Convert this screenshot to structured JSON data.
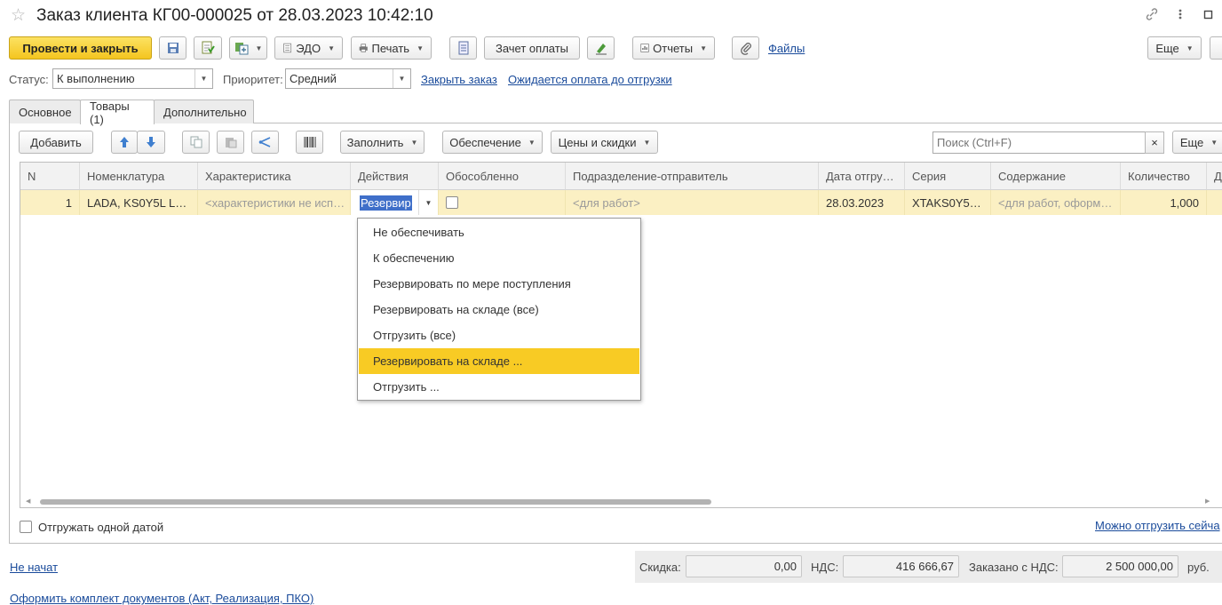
{
  "title": {
    "text": "Заказ клиента КГ00-000025 от 28.03.2023 10:42:10",
    "star_icon": "star-icon",
    "link_icon": "link-icon",
    "more_icon": "more-vertical-icon",
    "maximize_icon": "maximize-icon"
  },
  "toolbar": {
    "post_close": "Провести и закрыть",
    "edo": "ЭДО",
    "print": "Печать",
    "payment_offset": "Зачет оплаты",
    "reports": "Отчеты",
    "files": "Файлы",
    "more": "Еще"
  },
  "status_row": {
    "status_label": "Статус:",
    "status_value": "К выполнению",
    "priority_label": "Приоритет:",
    "priority_value": "Средний",
    "close_order_link": "Закрыть заказ",
    "payment_expected_link": "Ожидается оплата до отгрузки"
  },
  "tabs": [
    {
      "label": "Основное"
    },
    {
      "label": "Товары (1)"
    },
    {
      "label": "Дополнительно"
    }
  ],
  "table_toolbar": {
    "add": "Добавить",
    "fill": "Заполнить",
    "provision": "Обеспечение",
    "prices": "Цены и скидки",
    "search_placeholder": "Поиск (Ctrl+F)",
    "clear": "×",
    "more": "Еще"
  },
  "table": {
    "headers": [
      "N",
      "Номенклатура",
      "Характеристика",
      "Действия",
      "Обособленно",
      "Подразделение-отправитель",
      "Дата отгру…",
      "Серия",
      "Содержание",
      "Количество",
      "Д"
    ],
    "row": {
      "n": "1",
      "nomenclature": "LADA, KS0Y5L L…",
      "characteristic": "<характеристики не исп…",
      "action": "Резервир",
      "department": "<для работ>",
      "ship_date": "28.03.2023",
      "series": "XTAKS0Y5…",
      "content": "<для работ, оформ…",
      "quantity": "1,000"
    }
  },
  "dropdown": {
    "items": [
      "Не обеспечивать",
      "К обеспечению",
      "Резервировать по мере поступления",
      "Резервировать на складе (все)",
      "Отгрузить (все)",
      "Резервировать на складе ...",
      "Отгрузить ..."
    ],
    "selected_index": 5
  },
  "footer": {
    "ship_one_date": "Отгружать одной датой",
    "can_ship_now": "Можно отгрузить сейча",
    "not_started": "Не начат",
    "discount_label": "Скидка:",
    "discount_value": "0,00",
    "vat_label": "НДС:",
    "vat_value": "416 666,67",
    "ordered_label": "Заказано с НДС:",
    "ordered_value": "2 500 000,00",
    "currency": "руб.",
    "docs_link": "Оформить комплект документов (Акт, Реализация, ПКО)"
  },
  "colors": {
    "accent_yellow": "#f4c51f",
    "selected_row": "#fbf0c3",
    "link": "#1a4b9b"
  }
}
